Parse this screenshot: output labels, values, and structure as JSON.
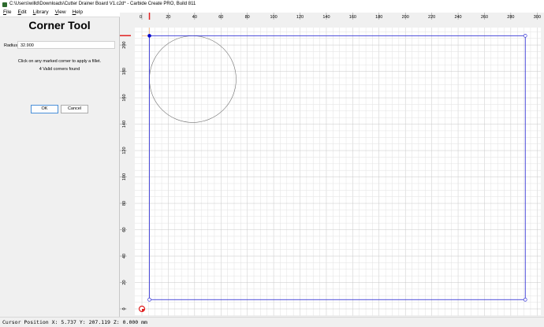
{
  "window": {
    "title": "C:\\Users\\willd\\Downloads\\Cutter Drainer Board  V1.c2d* - Carbide Create PRO, Build 811"
  },
  "menu": [
    {
      "first": "F",
      "rest": "ile"
    },
    {
      "first": "E",
      "rest": "dit"
    },
    {
      "first": "L",
      "rest": "ibrary"
    },
    {
      "first": "V",
      "rest": "iew"
    },
    {
      "first": "H",
      "rest": "elp"
    }
  ],
  "panel": {
    "title": "Corner Tool",
    "radius_label": "Radius",
    "radius_value": "32.900",
    "hint": "Click on any marked corner to apply a fillet.",
    "corners_found": "4 Valid corners found",
    "ok_label": "OK",
    "cancel_label": "Cancel"
  },
  "canvas": {
    "x_ticks": [
      0,
      20,
      40,
      60,
      80,
      100,
      120,
      140,
      160,
      180,
      200,
      220,
      240,
      260,
      280,
      300
    ],
    "y_ticks": [
      0,
      20,
      40,
      60,
      80,
      100,
      120,
      140,
      160,
      180,
      200
    ],
    "rect": {
      "x0": 5.7,
      "y0": 7,
      "x1": 291,
      "y1": 207
    },
    "circle": {
      "cx": 38.6,
      "cy": 174.1,
      "r": 32.9
    },
    "colors": {
      "rect": "#3a3ad6",
      "circle": "#707070",
      "grid_minor": "#e2e2e2",
      "grid_major": "#c8c8c8",
      "guide": "#f2b27a",
      "ruler_marker": "#e02020",
      "selected_corner": "#0000cc"
    }
  },
  "status": {
    "cursor": "Cursor Position X: 5.737 Y: 207.119 Z: 0.000 mm"
  }
}
